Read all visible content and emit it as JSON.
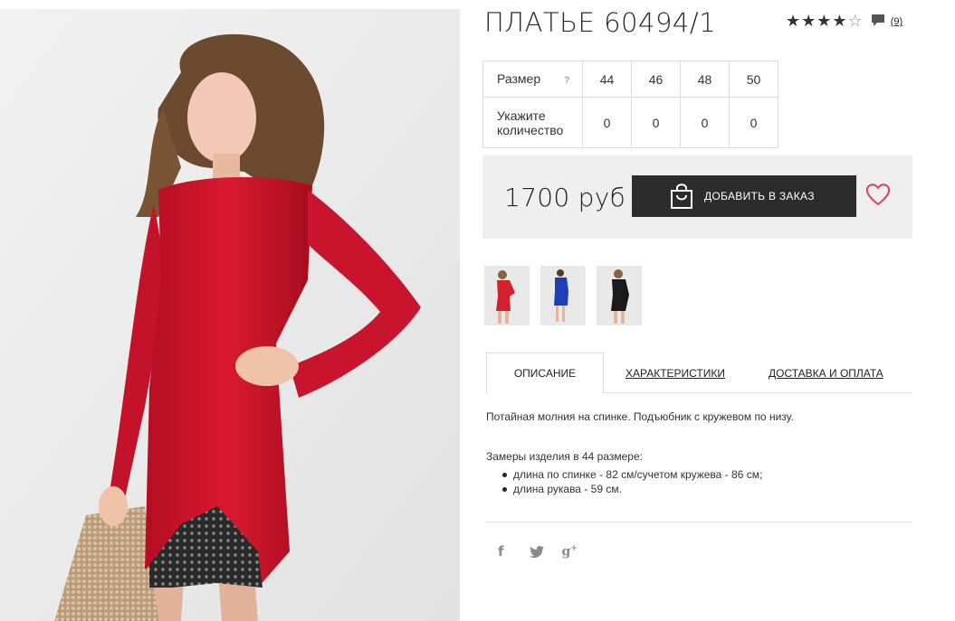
{
  "product": {
    "title": "ПЛАТЬЕ 60494/1",
    "rating": {
      "value": 4,
      "max": 5,
      "reviews_label": "(9)"
    },
    "sizes": {
      "size_label": "Размер",
      "help_label": "?",
      "values": [
        "44",
        "46",
        "48",
        "50"
      ],
      "quantity_label_line1": "Укажите",
      "quantity_label_line2": "количество",
      "quantities": [
        "0",
        "0",
        "0",
        "0"
      ]
    },
    "price": "1700 руб",
    "add_to_order_label": "ДОБАВИТЬ В ЗАКАЗ"
  },
  "thumbnails": [
    {
      "name": "red",
      "color": "#d2222e"
    },
    {
      "name": "blue",
      "color": "#1f3fb8"
    },
    {
      "name": "black",
      "color": "#1a1a1a"
    }
  ],
  "tabs": [
    {
      "label": "ОПИСАНИЕ",
      "active": true
    },
    {
      "label": "ХАРАКТЕРИСТИКИ",
      "active": false
    },
    {
      "label": "ДОСТАВКА И ОПЛАТА",
      "active": false
    }
  ],
  "description": {
    "paragraph1": "Потайная молния на спинке. Подъюбник с кружевом по низу.",
    "paragraph2": "Замеры изделия в 44 размере:",
    "bullets": [
      "длина по спинке - 82 см/сучетом кружева - 86 см;",
      "длина рукава - 59 см."
    ]
  },
  "social": {
    "facebook_glyph": "f",
    "googleplus_glyph": "g",
    "googleplus_sup": "+"
  },
  "colors": {
    "accent_dark": "#2c2c2c",
    "heart": "#d9445b",
    "dress": "#c8102e"
  },
  "icons": [
    "star-icon",
    "comment-icon",
    "shopping-bag-icon",
    "heart-icon",
    "facebook-icon",
    "twitter-icon",
    "google-plus-icon"
  ]
}
